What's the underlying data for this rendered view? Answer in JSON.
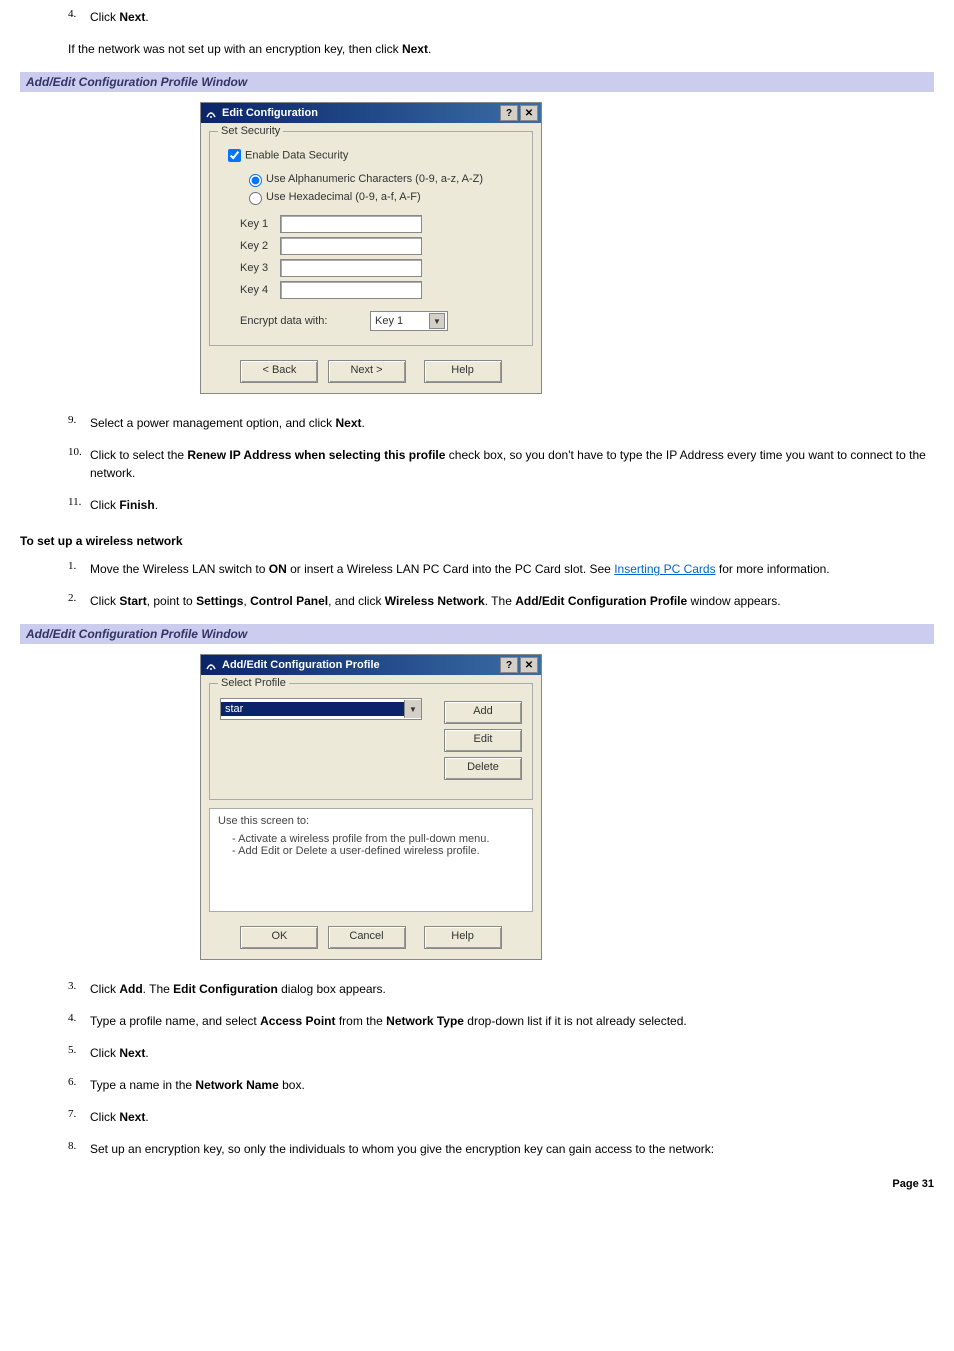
{
  "step4": {
    "num": "4.",
    "pre": "Click ",
    "bold": "Next",
    "post": "."
  },
  "step4_note": {
    "pre": "If the network was not set up with an encryption key, then click ",
    "bold": "Next",
    "post": "."
  },
  "heading1": "Add/Edit Configuration Profile Window",
  "dlg1": {
    "title": "Edit Configuration",
    "group_legend": "Set Security",
    "chk_enable": "Enable Data Security",
    "rad_alpha": "Use Alphanumeric Characters (0-9, a-z, A-Z)",
    "rad_hex": "Use Hexadecimal (0-9, a-f, A-F)",
    "key1": "Key 1",
    "key2": "Key 2",
    "key3": "Key 3",
    "key4": "Key 4",
    "encrypt_label": "Encrypt data with:",
    "encrypt_sel": "Key 1",
    "back": "< Back",
    "next": "Next >",
    "help": "Help"
  },
  "step9": {
    "num": "9.",
    "pre": "Select a power management option, and click ",
    "bold": "Next",
    "post": "."
  },
  "step10": {
    "num": "10.",
    "pre": "Click to select the ",
    "bold": "Renew IP Address when selecting this profile",
    "post": " check box, so you don't have to type the IP Address every time you want to connect to the network."
  },
  "step11": {
    "num": "11.",
    "pre": "Click ",
    "bold": "Finish",
    "post": "."
  },
  "subhead": "To set up a wireless network",
  "b1": {
    "num": "1.",
    "pre": "Move the Wireless LAN switch to ",
    "bold": "ON",
    "mid": " or insert a Wireless LAN PC Card into the PC Card slot. See ",
    "link": "Inserting PC Cards",
    "post": " for more information."
  },
  "b2": {
    "num": "2.",
    "pre": "Click ",
    "b1": "Start",
    "t1": ", point to ",
    "b2": "Settings",
    "t2": ", ",
    "b3": "Control Panel",
    "t3": ", and click ",
    "b4": "Wireless Network",
    "t4": ". The ",
    "b5": "Add/Edit Configuration Profile",
    "t5": " window appears."
  },
  "heading2": "Add/Edit Configuration Profile Window",
  "dlg2": {
    "title": "Add/Edit Configuration Profile",
    "group_legend": "Select Profile",
    "sel_val": "star",
    "add": "Add",
    "edit": "Edit",
    "delete": "Delete",
    "instr_head": "Use this screen to:",
    "instr1": "-  Activate a wireless profile from the pull-down menu.",
    "instr2": "-  Add Edit or Delete a user-defined wireless profile.",
    "ok": "OK",
    "cancel": "Cancel",
    "help": "Help"
  },
  "c3": {
    "num": "3.",
    "pre": "Click ",
    "b1": "Add",
    "t1": ". The ",
    "b2": "Edit Configuration",
    "t2": " dialog box appears."
  },
  "c4": {
    "num": "4.",
    "pre": "Type a profile name, and select ",
    "b1": "Access Point",
    "t1": " from the ",
    "b2": "Network Type",
    "t2": " drop-down list if it is not already selected."
  },
  "c5": {
    "num": "5.",
    "pre": "Click ",
    "b1": "Next",
    "t1": "."
  },
  "c6": {
    "num": "6.",
    "pre": "Type a name in the ",
    "b1": "Network Name",
    "t1": " box."
  },
  "c7": {
    "num": "7.",
    "pre": "Click ",
    "b1": "Next",
    "t1": "."
  },
  "c8": {
    "num": "8.",
    "pre": "Set up an encryption key, so only the individuals to whom you give the encryption key can gain access to the network:"
  },
  "page": "Page 31"
}
